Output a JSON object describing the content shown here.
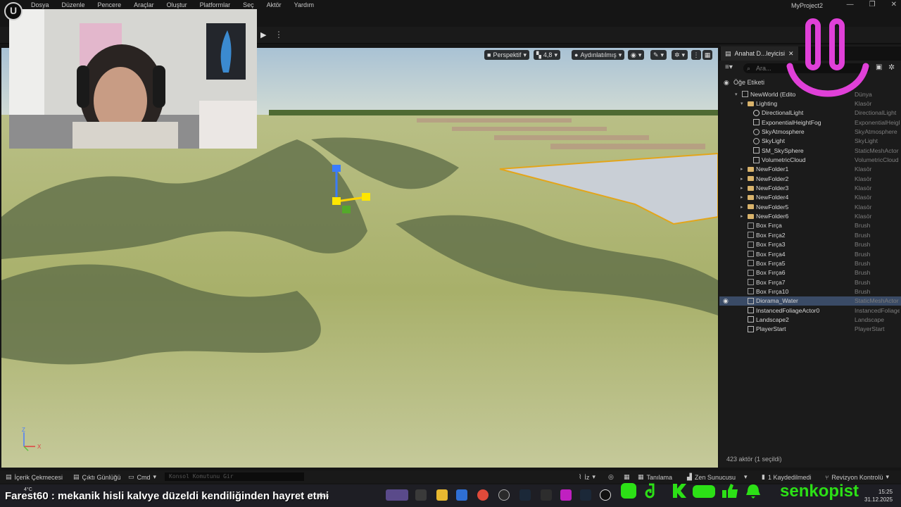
{
  "menu": {
    "items": [
      "Dosya",
      "Düzenle",
      "Pencere",
      "Araçlar",
      "Oluştur",
      "Platformlar",
      "Seç",
      "Aktör",
      "Yardım"
    ],
    "project_name": "MyProject2",
    "window_controls": [
      "—",
      "❐",
      "✕"
    ]
  },
  "viewport": {
    "perspective": "Perspektif",
    "camera_speed": "4,8",
    "lit_mode": "Aydınlatılmış",
    "axis": {
      "z": "Z",
      "x": "X"
    }
  },
  "outliner": {
    "tab_title": "Anahat D...leyicisi",
    "search_placeholder": "Ara...",
    "column_label": "Öğe Etiketi",
    "rows": [
      {
        "name": "NewWorld (Edito",
        "type": "Dünya",
        "indent": 0,
        "icon": "world-icon",
        "selected": false,
        "eye": false
      },
      {
        "name": "Lighting",
        "type": "Klasör",
        "indent": 1,
        "icon": "folder-icon",
        "selected": false,
        "eye": false
      },
      {
        "name": "DirectionalLight",
        "type": "DirectionalLight",
        "indent": 2,
        "icon": "light-icon",
        "selected": false,
        "eye": false
      },
      {
        "name": "ExponentialHeightFog",
        "type": "ExponentialHeigh",
        "indent": 2,
        "icon": "fog-icon",
        "selected": false,
        "eye": false
      },
      {
        "name": "SkyAtmosphere",
        "type": "SkyAtmosphere",
        "indent": 2,
        "icon": "sky-icon",
        "selected": false,
        "eye": false
      },
      {
        "name": "SkyLight",
        "type": "SkyLight",
        "indent": 2,
        "icon": "skylight-icon",
        "selected": false,
        "eye": false
      },
      {
        "name": "SM_SkySphere",
        "type": "StaticMeshActor",
        "indent": 2,
        "icon": "mesh-icon",
        "selected": false,
        "eye": false
      },
      {
        "name": "VolumetricCloud",
        "type": "VolumetricCloud",
        "indent": 2,
        "icon": "cloud-icon",
        "selected": false,
        "eye": false
      },
      {
        "name": "NewFolder1",
        "type": "Klasör",
        "indent": 1,
        "icon": "folder-icon",
        "selected": false,
        "eye": false
      },
      {
        "name": "NewFolder2",
        "type": "Klasör",
        "indent": 1,
        "icon": "folder-icon",
        "selected": false,
        "eye": false
      },
      {
        "name": "NewFolder3",
        "type": "Klasör",
        "indent": 1,
        "icon": "folder-icon",
        "selected": false,
        "eye": false
      },
      {
        "name": "NewFolder4",
        "type": "Klasör",
        "indent": 1,
        "icon": "folder-icon",
        "selected": false,
        "eye": false
      },
      {
        "name": "NewFolder5",
        "type": "Klasör",
        "indent": 1,
        "icon": "folder-icon",
        "selected": false,
        "eye": false
      },
      {
        "name": "NewFolder6",
        "type": "Klasör",
        "indent": 1,
        "icon": "folder-icon",
        "selected": false,
        "eye": false
      },
      {
        "name": "Box Fırça",
        "type": "Brush",
        "indent": 1,
        "icon": "brush-icon",
        "selected": false,
        "eye": false
      },
      {
        "name": "Box Fırça2",
        "type": "Brush",
        "indent": 1,
        "icon": "brush-icon",
        "selected": false,
        "eye": false
      },
      {
        "name": "Box Fırça3",
        "type": "Brush",
        "indent": 1,
        "icon": "brush-icon",
        "selected": false,
        "eye": false
      },
      {
        "name": "Box Fırça4",
        "type": "Brush",
        "indent": 1,
        "icon": "brush-icon",
        "selected": false,
        "eye": false
      },
      {
        "name": "Box Fırça5",
        "type": "Brush",
        "indent": 1,
        "icon": "brush-icon",
        "selected": false,
        "eye": false
      },
      {
        "name": "Box Fırça6",
        "type": "Brush",
        "indent": 1,
        "icon": "brush-icon",
        "selected": false,
        "eye": false
      },
      {
        "name": "Box Fırça7",
        "type": "Brush",
        "indent": 1,
        "icon": "brush-icon",
        "selected": false,
        "eye": false
      },
      {
        "name": "Box Fırça10",
        "type": "Brush",
        "indent": 1,
        "icon": "brush-icon",
        "selected": false,
        "eye": false
      },
      {
        "name": "Diorama_Water",
        "type": "StaticMeshActor",
        "indent": 1,
        "icon": "mesh-icon",
        "selected": true,
        "eye": true
      },
      {
        "name": "InstancedFoliageActor0",
        "type": "InstancedFoliage",
        "indent": 1,
        "icon": "foliage-icon",
        "selected": false,
        "eye": false
      },
      {
        "name": "Landscape2",
        "type": "Landscape",
        "indent": 1,
        "icon": "landscape-icon",
        "selected": false,
        "eye": false
      },
      {
        "name": "PlayerStart",
        "type": "PlayerStart",
        "indent": 1,
        "icon": "playerstart-icon",
        "selected": false,
        "eye": false
      }
    ],
    "footer": "423 aktör (1 seçildi)"
  },
  "statusbar": {
    "content_drawer": "İçerik Çekmecesi",
    "output_log": "Çıktı Günlüğü",
    "cmd": "Cmd",
    "console_placeholder": "Konsol Komutunu Gir",
    "trace": "İz",
    "diagnostics": "Tanılama",
    "zen": "Zen Sunucusu",
    "unsaved": "1 Kaydedilmedi",
    "revision": "Revizyon Kontrolü"
  },
  "taskbar": {
    "temp": "4°C",
    "ticker_user": "Farest60",
    "ticker_msg": " : mekanik hisli kalvye düzeldi kendiliğinden hayret etmi",
    "search": "Ara",
    "brand": "senkopist",
    "time": "15:25",
    "date": "31.12.2025"
  },
  "colors": {
    "accent_green": "#2ce016",
    "selection": "#3a4b66",
    "smile_pink": "#e040d8"
  }
}
